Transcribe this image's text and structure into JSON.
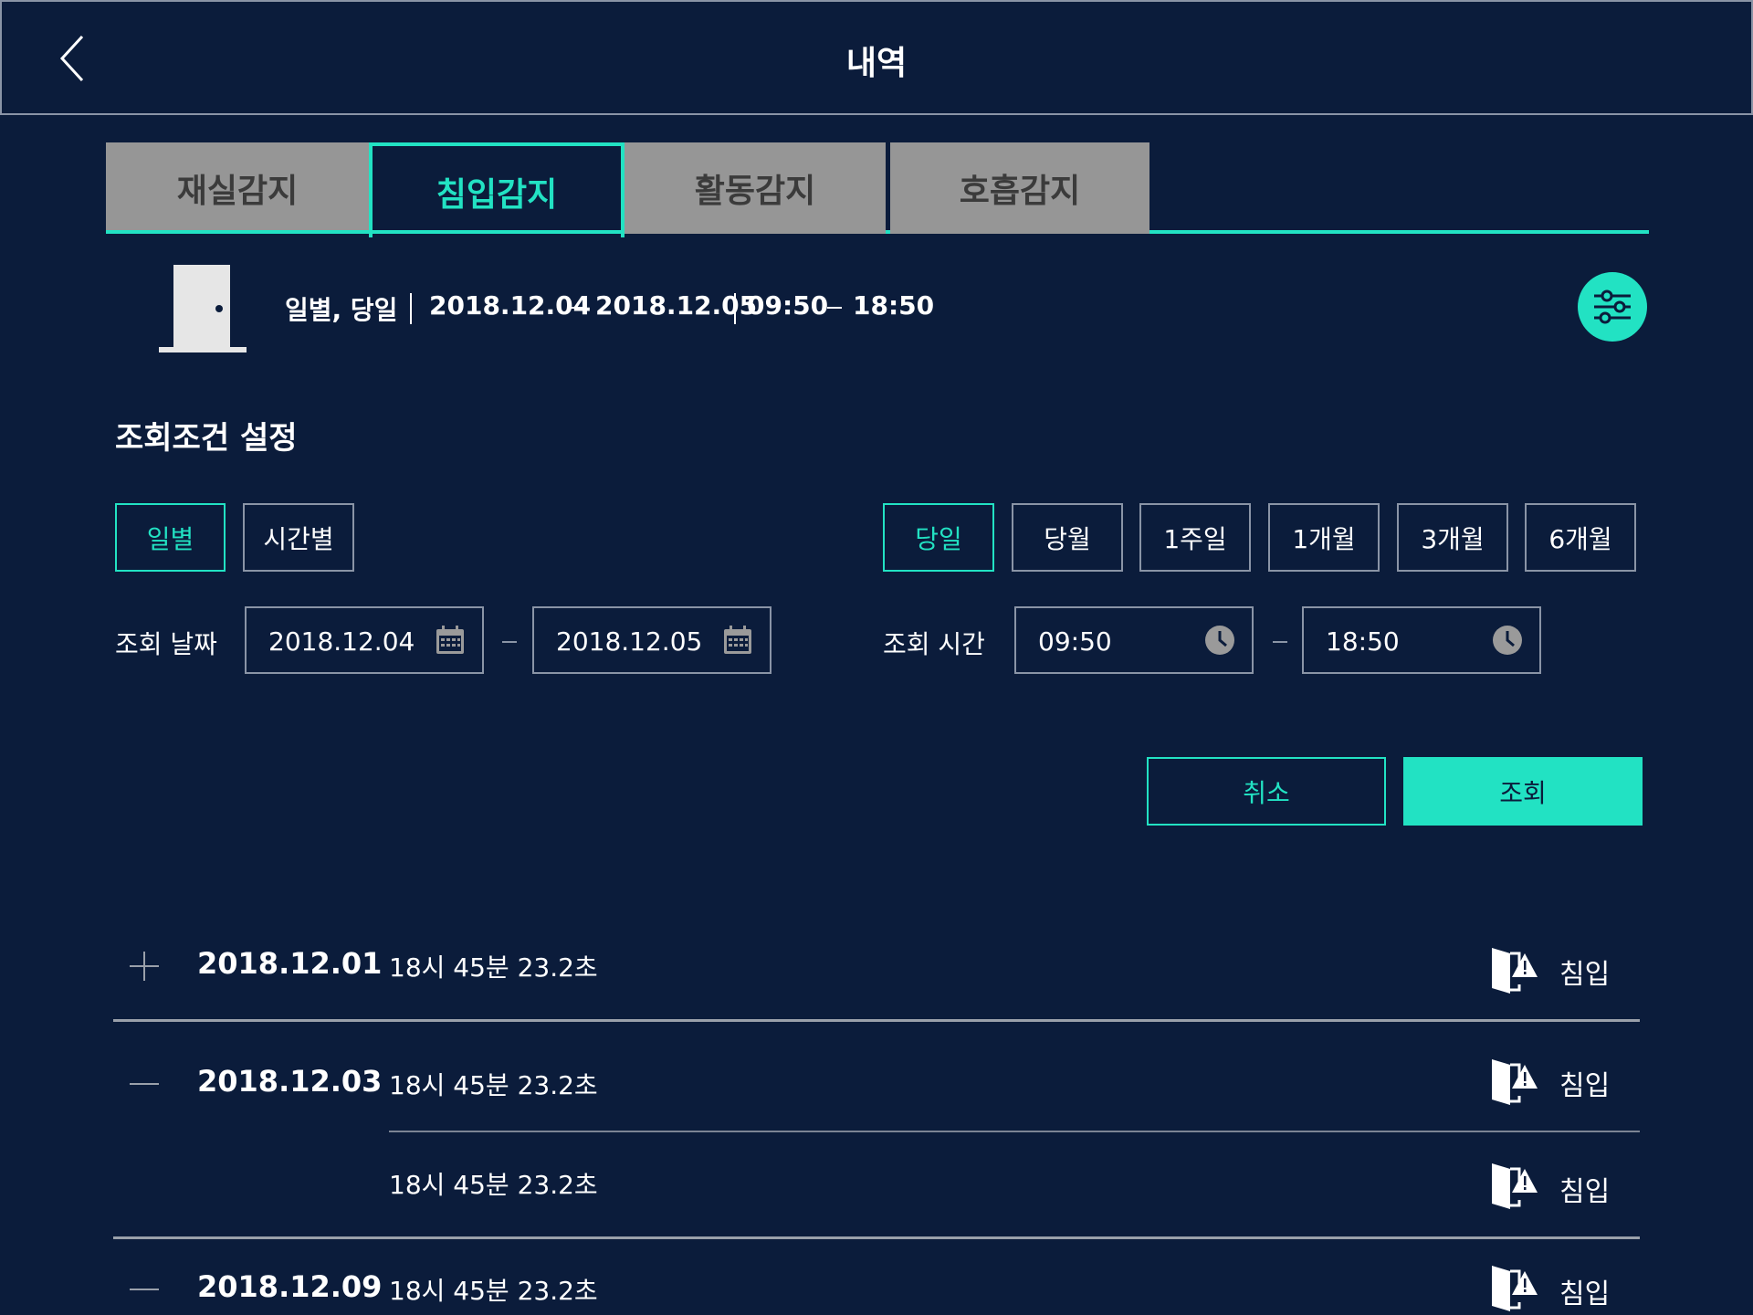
{
  "header": {
    "title": "내역"
  },
  "tabs": [
    {
      "label": "재실감지",
      "active": false
    },
    {
      "label": "침입감지",
      "active": true
    },
    {
      "label": "활동감지",
      "active": false
    },
    {
      "label": "호흡감지",
      "active": false
    }
  ],
  "summary": {
    "mode": "일별, 당일",
    "date_start": "2018.12.04",
    "date_end": "2018.12.05",
    "time_start": "09:50",
    "time_end": "18:50"
  },
  "conditions": {
    "title": "조회조건 설정",
    "unit_options": [
      {
        "label": "일별",
        "selected": true
      },
      {
        "label": "시간별",
        "selected": false
      }
    ],
    "period_options": [
      {
        "label": "당일",
        "selected": true
      },
      {
        "label": "당월",
        "selected": false
      },
      {
        "label": "1주일",
        "selected": false
      },
      {
        "label": "1개월",
        "selected": false
      },
      {
        "label": "3개월",
        "selected": false
      },
      {
        "label": "6개월",
        "selected": false
      }
    ],
    "date_label": "조회 날짜",
    "date_from": "2018.12.04",
    "date_to": "2018.12.05",
    "time_label": "조회 시간",
    "time_from": "09:50",
    "time_to": "18:50",
    "cancel_label": "취소",
    "search_label": "조회"
  },
  "records": [
    {
      "date": "2018.12.01",
      "time": "18시 45분 23.2초",
      "event": "침입"
    },
    {
      "date": "2018.12.03",
      "time": "18시 45분 23.2초",
      "event": "침입"
    },
    {
      "date": "",
      "time": "18시 45분 23.2초",
      "event": "침입"
    },
    {
      "date": "2018.12.09",
      "time": "18시 45분 23.2초",
      "event": "침입"
    }
  ],
  "colors": {
    "background": "#0b1c3b",
    "accent": "#22e2c3",
    "tab_inactive": "#969696"
  }
}
